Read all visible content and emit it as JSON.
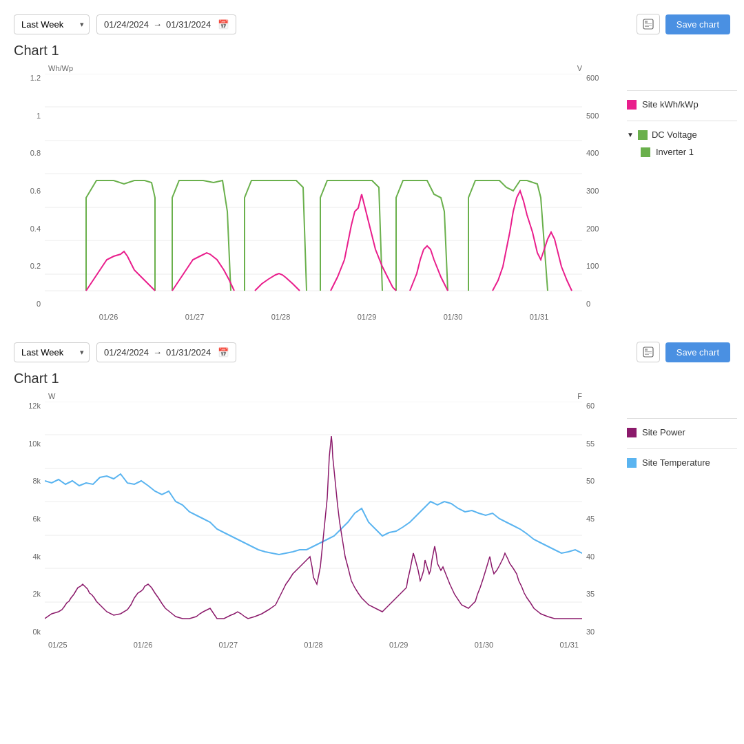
{
  "chart1": {
    "title": "Chart 1",
    "toolbar": {
      "period": "Last Week",
      "date_from": "01/24/2024",
      "date_to": "01/31/2024",
      "save_label": "Save chart"
    },
    "y_left_unit": "Wh/Wp",
    "y_right_unit": "V",
    "y_left_ticks": [
      "1.2",
      "1",
      "0.8",
      "0.6",
      "0.4",
      "0.2",
      "0"
    ],
    "y_right_ticks": [
      "600",
      "500",
      "400",
      "300",
      "200",
      "100",
      "0"
    ],
    "x_ticks": [
      "01/26",
      "01/27",
      "01/28",
      "01/29",
      "01/30",
      "01/31"
    ],
    "legend": {
      "site_kwh": "Site kWh/kWp",
      "dc_voltage": "DC Voltage",
      "inverter1": "Inverter 1"
    }
  },
  "chart2": {
    "title": "Chart 1",
    "toolbar": {
      "period": "Last Week",
      "date_from": "01/24/2024",
      "date_to": "01/31/2024",
      "save_label": "Save chart"
    },
    "y_left_unit": "W",
    "y_right_unit": "F",
    "y_left_ticks": [
      "12k",
      "10k",
      "8k",
      "6k",
      "4k",
      "2k",
      "0k"
    ],
    "y_right_ticks": [
      "60",
      "55",
      "50",
      "45",
      "40",
      "35",
      "30"
    ],
    "x_ticks": [
      "01/25",
      "01/26",
      "01/27",
      "01/28",
      "01/29",
      "01/30",
      "01/31"
    ],
    "legend": {
      "site_power": "Site Power",
      "site_temperature": "Site Temperature"
    }
  },
  "colors": {
    "pink": "#e91e8c",
    "green": "#6ab04c",
    "blue": "#5ab4f0",
    "purple": "#8b1a6b",
    "save_btn": "#4a90e2"
  }
}
